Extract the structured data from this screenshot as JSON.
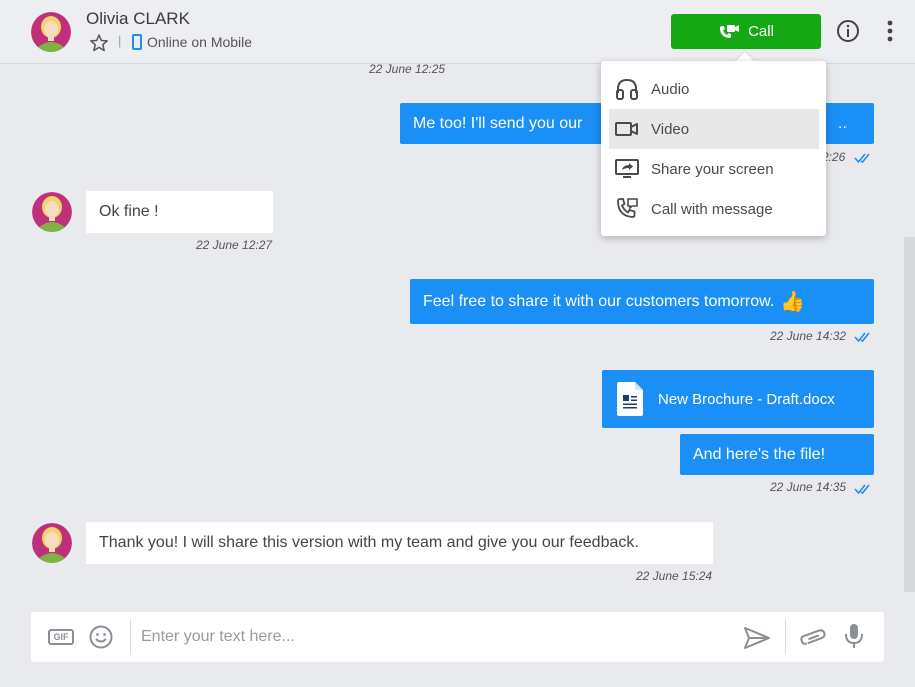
{
  "header": {
    "contact_name": "Olivia CLARK",
    "separator": "|",
    "presence": "Online on Mobile",
    "call_label": "Call"
  },
  "call_menu": {
    "items": [
      {
        "label": "Audio",
        "icon": "headphones-icon"
      },
      {
        "label": "Video",
        "icon": "video-camera-icon",
        "highlighted": true
      },
      {
        "label": "Share your screen",
        "icon": "share-screen-icon"
      },
      {
        "label": "Call with message",
        "icon": "phone-message-icon"
      }
    ]
  },
  "messages": [
    {
      "direction": "timestamp",
      "time": "22 June 12:25"
    },
    {
      "direction": "out",
      "text": "Me too! I'll send you our",
      "text_tail": "..",
      "time": "2:26",
      "read": true
    },
    {
      "direction": "in",
      "text": "Ok fine !",
      "time": "22 June 12:27"
    },
    {
      "direction": "out",
      "text": "Feel free to share it with our customers tomorrow.",
      "emoji": "👍",
      "time": "22 June 14:32",
      "read": true
    },
    {
      "direction": "out",
      "type": "file",
      "file_name": "New Brochure - Draft.docx"
    },
    {
      "direction": "out",
      "text": "And here's the file!",
      "time": "22 June 14:35",
      "read": true
    },
    {
      "direction": "in",
      "text": "Thank you! I will share this version with my team and give you our feedback.",
      "time": "22 June 15:24"
    }
  ],
  "composer": {
    "placeholder": "Enter your text here...",
    "value": "",
    "gif_label": "GIF"
  },
  "colors": {
    "accent": "#1a8ff5",
    "call_green": "#14a814",
    "background": "#e9eaee",
    "avatar_ring": "#c0307a"
  }
}
